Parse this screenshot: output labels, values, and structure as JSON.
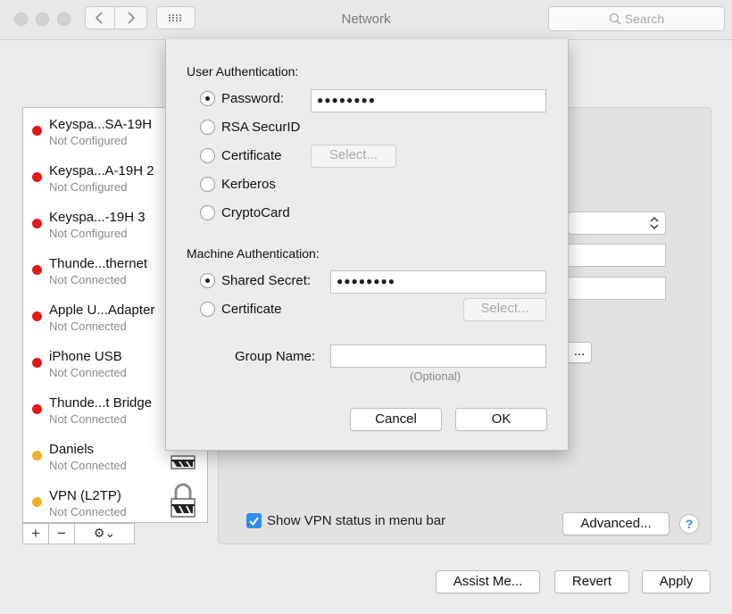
{
  "window": {
    "title": "Network"
  },
  "search": {
    "placeholder": "Search",
    "icon": "search-icon"
  },
  "sidebar": {
    "services": [
      {
        "name": "Keyspa...SA-19H",
        "status": "Not Configured",
        "status_color": "#e0191a"
      },
      {
        "name": "Keyspa...A-19H  2",
        "status": "Not Configured",
        "status_color": "#e0191a"
      },
      {
        "name": "Keyspa...-19H  3",
        "status": "Not Configured",
        "status_color": "#e0191a"
      },
      {
        "name": "Thunde...thernet",
        "status": "Not Connected",
        "status_color": "#e0191a"
      },
      {
        "name": "Apple U...Adapter",
        "status": "Not Connected",
        "status_color": "#e0191a"
      },
      {
        "name": "iPhone USB",
        "status": "Not Connected",
        "status_color": "#e0191a"
      },
      {
        "name": "Thunde...t Bridge",
        "status": "Not Connected",
        "status_color": "#e0191a"
      },
      {
        "name": "Daniels",
        "status": "Not Connected",
        "status_color": "#f0b12a"
      },
      {
        "name": "VPN (L2TP)",
        "status": "Not Connected",
        "status_color": "#f0b12a"
      }
    ],
    "add_label": "+",
    "remove_label": "−",
    "action_label": "⚙⌄"
  },
  "main": {
    "show_vpn_status_label": "Show VPN status in menu bar",
    "show_vpn_status_checked": true,
    "advanced_label": "Advanced...",
    "help_label": "?",
    "partial_button_label": "..."
  },
  "footer": {
    "assist_label": "Assist Me...",
    "revert_label": "Revert",
    "apply_label": "Apply"
  },
  "sheet": {
    "user_auth_label": "User Authentication:",
    "user_auth_options": [
      {
        "label": "Password:",
        "selected": true
      },
      {
        "label": "RSA SecurID",
        "selected": false
      },
      {
        "label": "Certificate",
        "selected": false
      },
      {
        "label": "Kerberos",
        "selected": false
      },
      {
        "label": "CryptoCard",
        "selected": false
      }
    ],
    "password_value": "●●●●●●●●",
    "user_cert_select_label": "Select...",
    "machine_auth_label": "Machine Authentication:",
    "machine_auth_options": [
      {
        "label": "Shared Secret:",
        "selected": true
      },
      {
        "label": "Certificate",
        "selected": false
      }
    ],
    "shared_secret_value": "●●●●●●●●",
    "machine_cert_select_label": "Select...",
    "group_name_label": "Group Name:",
    "group_name_value": "",
    "group_name_hint": "(Optional)",
    "cancel_label": "Cancel",
    "ok_label": "OK"
  }
}
